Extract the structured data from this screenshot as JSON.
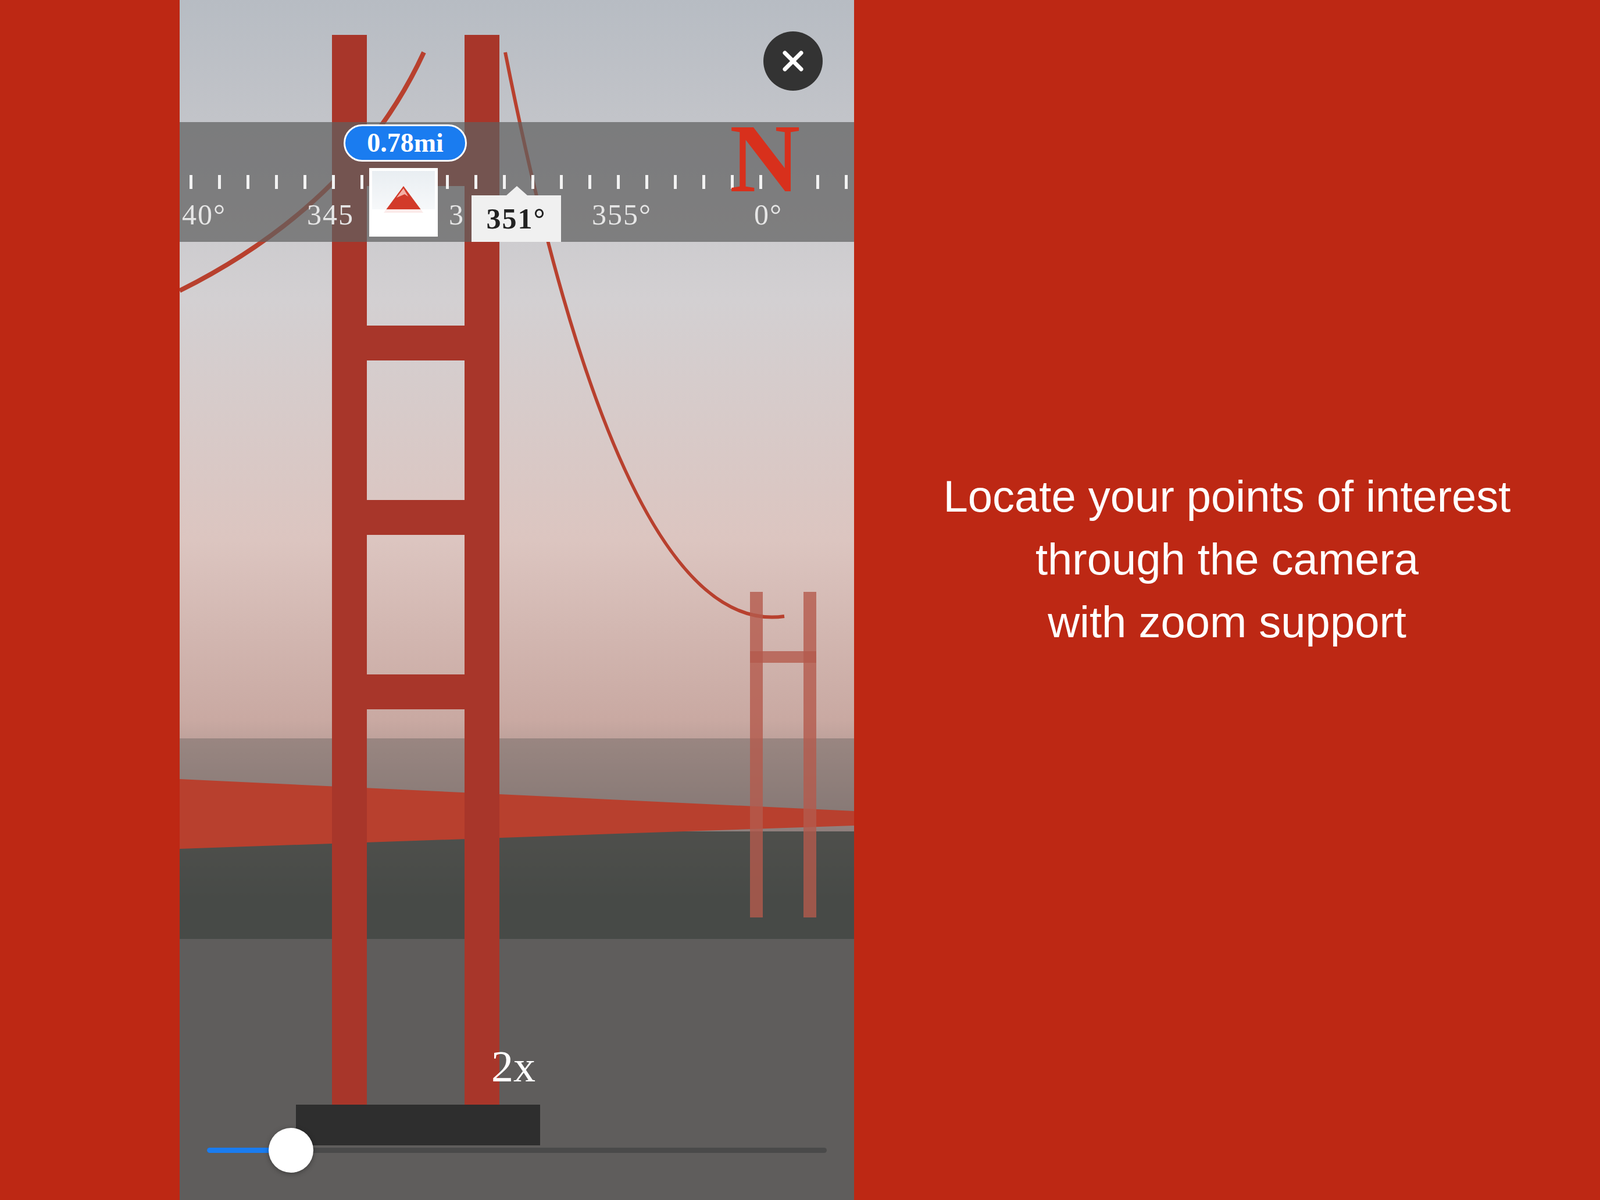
{
  "screen": {
    "compass": {
      "distance_badge": "0.78mi",
      "heading": "351°",
      "north": "N",
      "labels": [
        "40°",
        "345",
        "3",
        "355°",
        "0°"
      ]
    },
    "zoom": {
      "label": "2x",
      "level": 0.135
    }
  },
  "caption": [
    "Locate your points of interest",
    "through the camera",
    "with zoom support"
  ]
}
